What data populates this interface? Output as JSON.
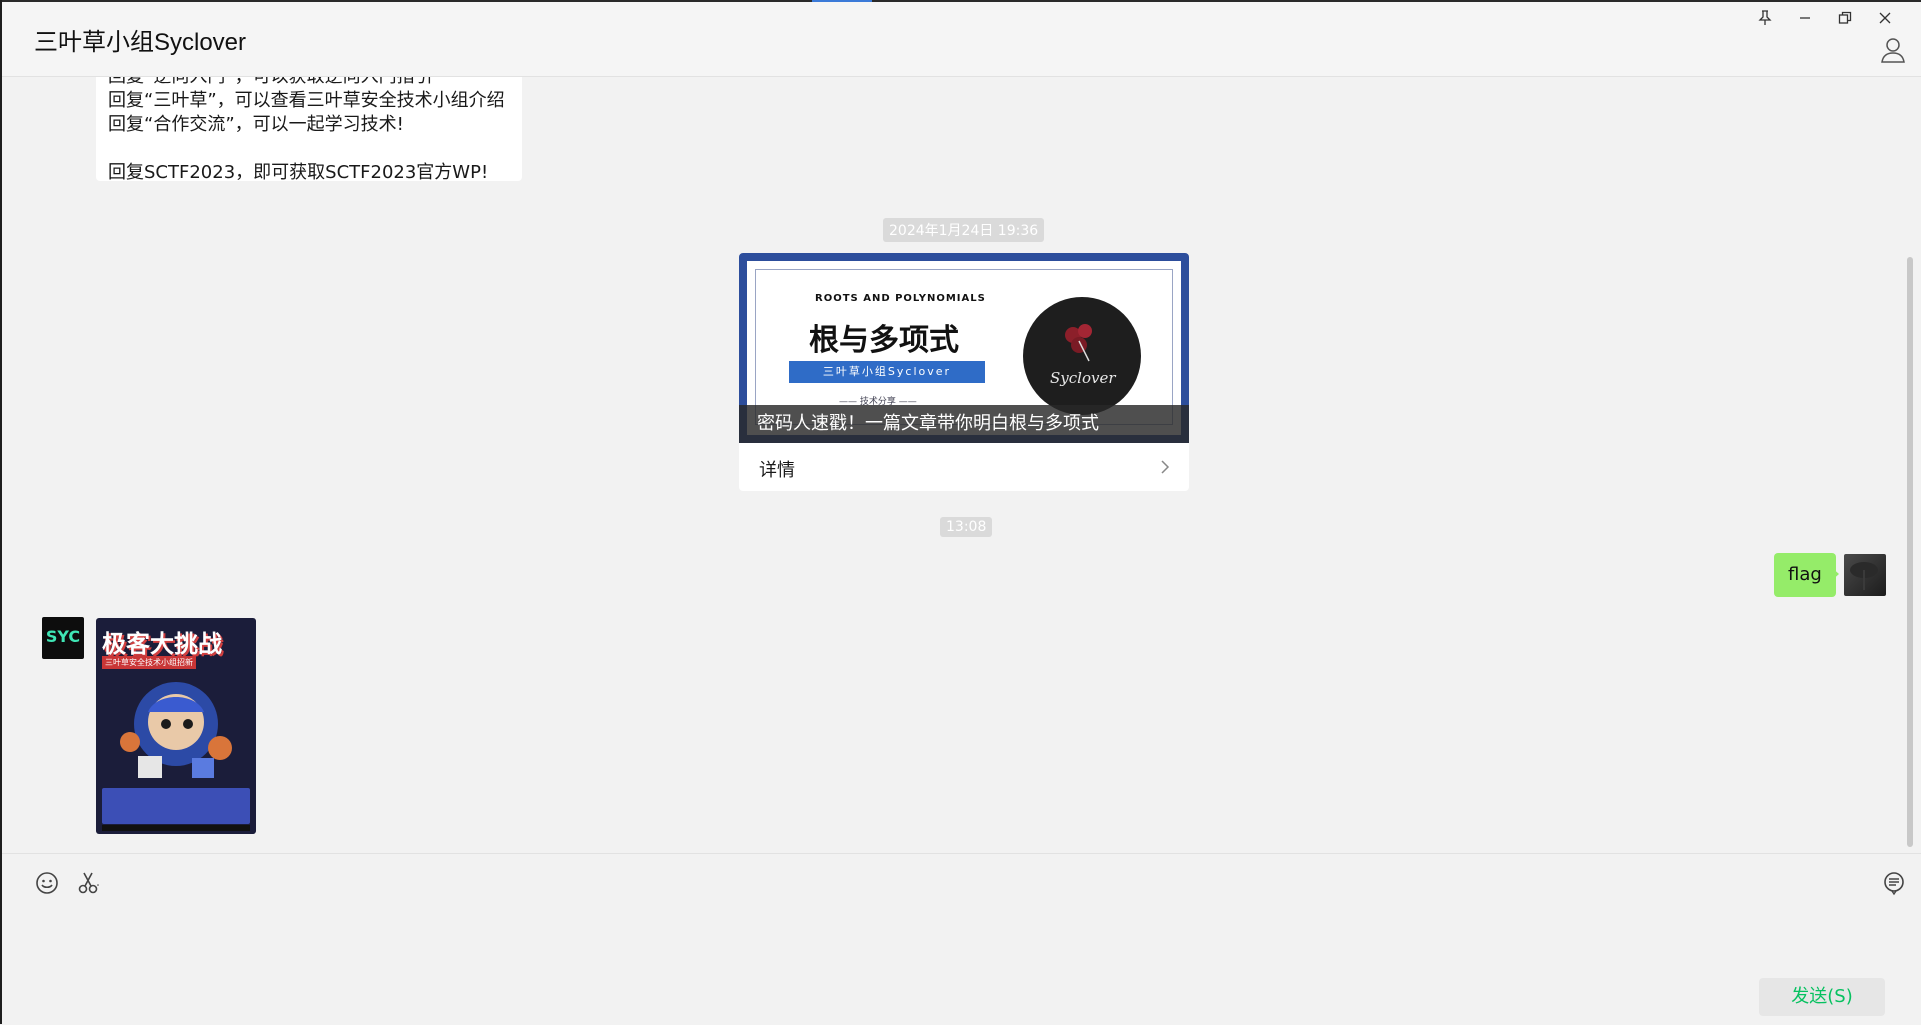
{
  "window": {
    "title": "三叶草小组Syclover",
    "controls": {
      "pin": "pin-icon",
      "minimize": "minimize-icon",
      "restore": "restore-icon",
      "close": "close-icon"
    }
  },
  "messages": {
    "intro": {
      "lines": [
        "回复“逆向入门”，可以获取逆向入门指引",
        "回复“三叶草”，可以查看三叶草安全技术小组介绍",
        "回复“合作交流”，可以一起学习技术!",
        "",
        "回复SCTF2023，即可获取SCTF2023官方WP!"
      ]
    },
    "timestamp_1": "2024年1月24日 19:36",
    "article": {
      "cover_en": "ROOTS AND POLYNOMIALS",
      "cover_cn": "根与多项式",
      "cover_ribbon": "三叶草小组Syclover",
      "cover_tag": "—— 技术分享 ——",
      "cover_logo": "Syclover",
      "caption": "密码人速戳！一篇文章带你明白根与多项式",
      "detail": "详情"
    },
    "timestamp_2": "13:08",
    "outgoing": {
      "text": "flag"
    },
    "incoming_image": {
      "poster_title": "极客大挑战",
      "poster_subtitle": "三叶草安全技术小组招新"
    },
    "avatar_text": "SYC"
  },
  "composer": {
    "send_label": "发送(S)"
  },
  "colors": {
    "bubble_self": "#95ec69",
    "send_text": "#07c160",
    "background": "#f2f2f2"
  }
}
